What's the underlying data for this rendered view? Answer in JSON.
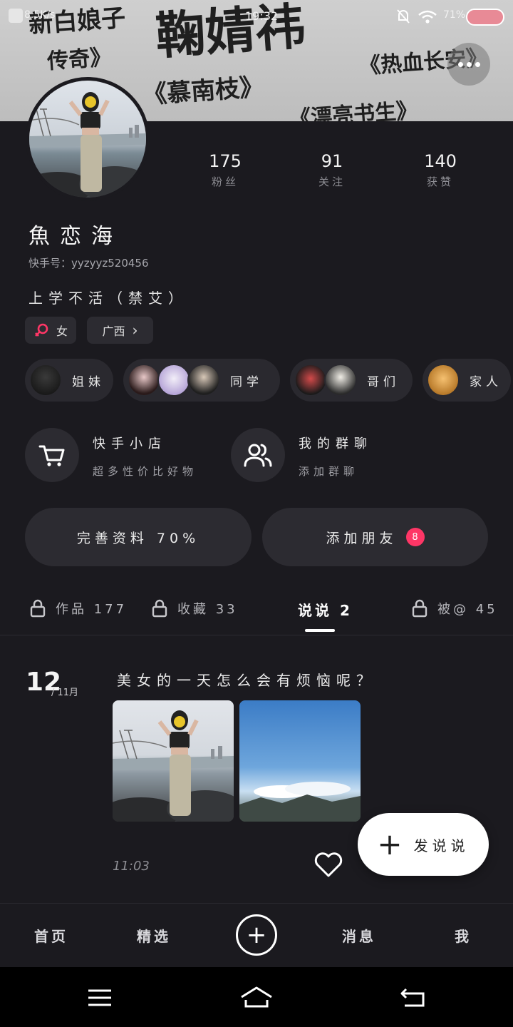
{
  "status_bar": {
    "net_speed": "8.5K/s",
    "time": "19:32",
    "battery": "71%"
  },
  "banner": {
    "calligraphy": [
      "新白娘子",
      "传奇》",
      "鞠婧祎",
      "《热血长安》",
      "《慕南枝》",
      "《漂亮书生》"
    ]
  },
  "profile": {
    "stats": [
      {
        "value": "175",
        "label": "粉丝"
      },
      {
        "value": "91",
        "label": "关注"
      },
      {
        "value": "140",
        "label": "获赞"
      }
    ],
    "name": "魚恋海",
    "uid": "快手号：yyzyyz520456",
    "bio": "上学不活（禁艾）",
    "gender_chip": "女",
    "location_chip": "广西"
  },
  "groups": [
    {
      "label": "姐妹"
    },
    {
      "label": "同学"
    },
    {
      "label": "哥们"
    },
    {
      "label": "家人"
    }
  ],
  "features": {
    "shop": {
      "title": "快手小店",
      "subtitle": "超多性价比好物"
    },
    "group_chat": {
      "title": "我的群聊",
      "subtitle": "添加群聊"
    }
  },
  "actions": {
    "complete_profile": "完善资料 70%",
    "add_friends": "添加朋友",
    "add_friends_badge": "8"
  },
  "tabs": [
    {
      "label": "作品 177",
      "locked": true
    },
    {
      "label": "收藏 33",
      "locked": true
    },
    {
      "label": "说说 2",
      "locked": false
    },
    {
      "label": "被@ 45",
      "locked": true
    }
  ],
  "post": {
    "day": "12",
    "month": "/ 11月",
    "text": "美女的一天怎么会有烦恼呢？",
    "time": "11:03"
  },
  "fab": {
    "label": "发说说"
  },
  "bottom_nav": {
    "home": "首页",
    "featured": "精选",
    "messages": "消息",
    "me": "我"
  },
  "colors": {
    "background": "#1b1a1f",
    "surface": "#2c2b31",
    "badge": "#fe3666",
    "female_icon": "#fe3666"
  }
}
